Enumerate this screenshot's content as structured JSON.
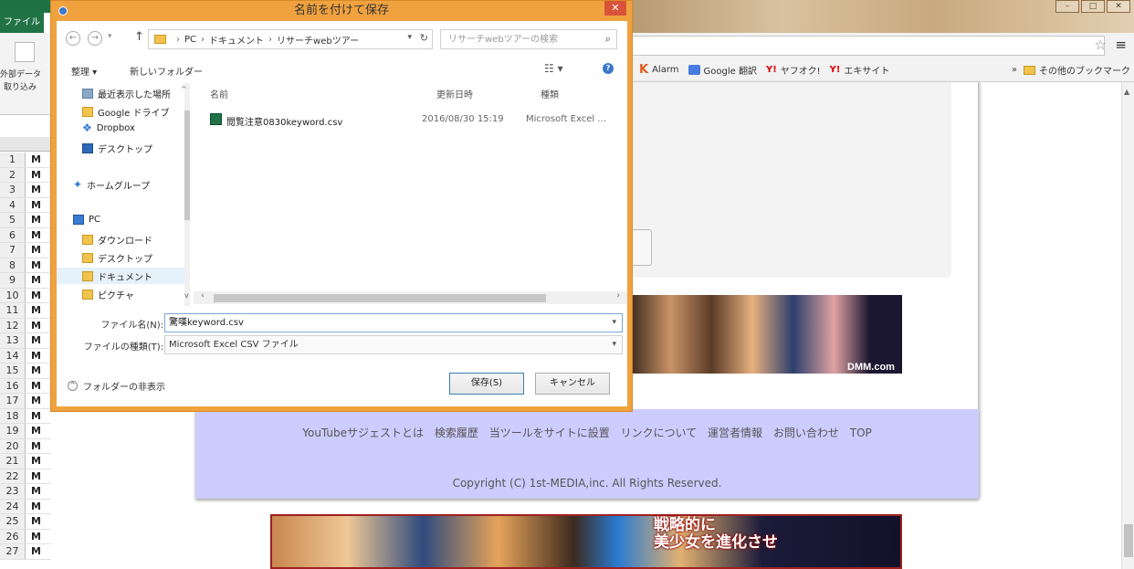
{
  "excel": {
    "file_tab": "ファイル",
    "ribbon_group_1": "外部データ",
    "ribbon_group_2": "取り込み",
    "rows": [
      {
        "num": "1",
        "cell": "M"
      },
      {
        "num": "2",
        "cell": "M"
      },
      {
        "num": "3",
        "cell": "M"
      },
      {
        "num": "4",
        "cell": "M"
      },
      {
        "num": "5",
        "cell": "M"
      },
      {
        "num": "6",
        "cell": "M"
      },
      {
        "num": "7",
        "cell": "M"
      },
      {
        "num": "8",
        "cell": "M"
      },
      {
        "num": "9",
        "cell": "M"
      },
      {
        "num": "10",
        "cell": "M"
      },
      {
        "num": "11",
        "cell": "M"
      },
      {
        "num": "12",
        "cell": "M"
      },
      {
        "num": "13",
        "cell": "M"
      },
      {
        "num": "14",
        "cell": "M"
      },
      {
        "num": "15",
        "cell": "M"
      },
      {
        "num": "16",
        "cell": "M"
      },
      {
        "num": "17",
        "cell": "M"
      },
      {
        "num": "18",
        "cell": "M"
      },
      {
        "num": "19",
        "cell": "M"
      },
      {
        "num": "20",
        "cell": "M"
      },
      {
        "num": "21",
        "cell": "M"
      },
      {
        "num": "22",
        "cell": "M"
      },
      {
        "num": "23",
        "cell": "M"
      },
      {
        "num": "24",
        "cell": "M"
      },
      {
        "num": "25",
        "cell": "M"
      },
      {
        "num": "26",
        "cell": "M"
      },
      {
        "num": "27",
        "cell": "M"
      }
    ]
  },
  "browser": {
    "bookmarks": [
      {
        "label": "Alarm",
        "icon": "k-icon"
      },
      {
        "label": "Google 翻訳",
        "icon": "google-translate-icon"
      },
      {
        "label": "ヤフオク!",
        "icon": "yahoo-icon"
      },
      {
        "label": "エキサイト",
        "icon": "yahoo-icon"
      }
    ],
    "bookmarks_overflow": "»",
    "other_bookmarks": "その他のブックマーク",
    "banner1_logo": "DMM.com",
    "banner2_text_line1": "戦略的に",
    "banner2_text_line2": "美少女を進化させ",
    "footer_links": [
      "YouTubeサジェストとは",
      "検索履歴",
      "当ツールをサイトに設置",
      "リンクについて",
      "運営者情報",
      "お問い合わせ",
      "TOP"
    ],
    "footer_copyright": "Copyright (C) 1st-MEDIA,inc. All Rights Reserved."
  },
  "dialog": {
    "title": "名前を付けて保存",
    "close": "✕",
    "address": [
      "PC",
      "ドキュメント",
      "リサーチwebツアー"
    ],
    "search_placeholder": "リサーチwebツアーの検索",
    "organize": "整理 ▾",
    "new_folder": "新しいフォルダー",
    "nav_items": [
      {
        "label": "最近表示した場所",
        "icon": "recent-places-icon"
      },
      {
        "label": "Google ドライブ",
        "icon": "google-drive-icon"
      },
      {
        "label": "Dropbox",
        "icon": "dropbox-icon"
      },
      {
        "label": "デスクトップ",
        "icon": "desktop-icon"
      },
      {
        "label": "ホームグループ",
        "icon": "homegroup-icon"
      },
      {
        "label": "PC",
        "icon": "pc-icon"
      },
      {
        "label": "ダウンロード",
        "icon": "download-folder-icon"
      },
      {
        "label": "デスクトップ",
        "icon": "desktop-folder-icon"
      },
      {
        "label": "ドキュメント",
        "icon": "documents-folder-icon"
      },
      {
        "label": "ピクチャ",
        "icon": "pictures-folder-icon"
      }
    ],
    "columns": {
      "name": "名前",
      "modified": "更新日時",
      "type": "種類"
    },
    "files": [
      {
        "name": "閲覧注意0830keyword.csv",
        "modified": "2016/08/30 15:19",
        "type": "Microsoft Excel ..."
      }
    ],
    "filename_label": "ファイル名(N):",
    "filename_value": "驚嘆keyword.csv",
    "filetype_label": "ファイルの種類(T):",
    "filetype_value": "Microsoft Excel CSV ファイル",
    "hide_folders": "フォルダーの非表示",
    "save_button": "保存(S)",
    "cancel_button": "キャンセル"
  },
  "colors": {
    "dialog_frame": "#f0a23f",
    "footer_bg": "#ccccff",
    "excel_green": "#217346"
  }
}
